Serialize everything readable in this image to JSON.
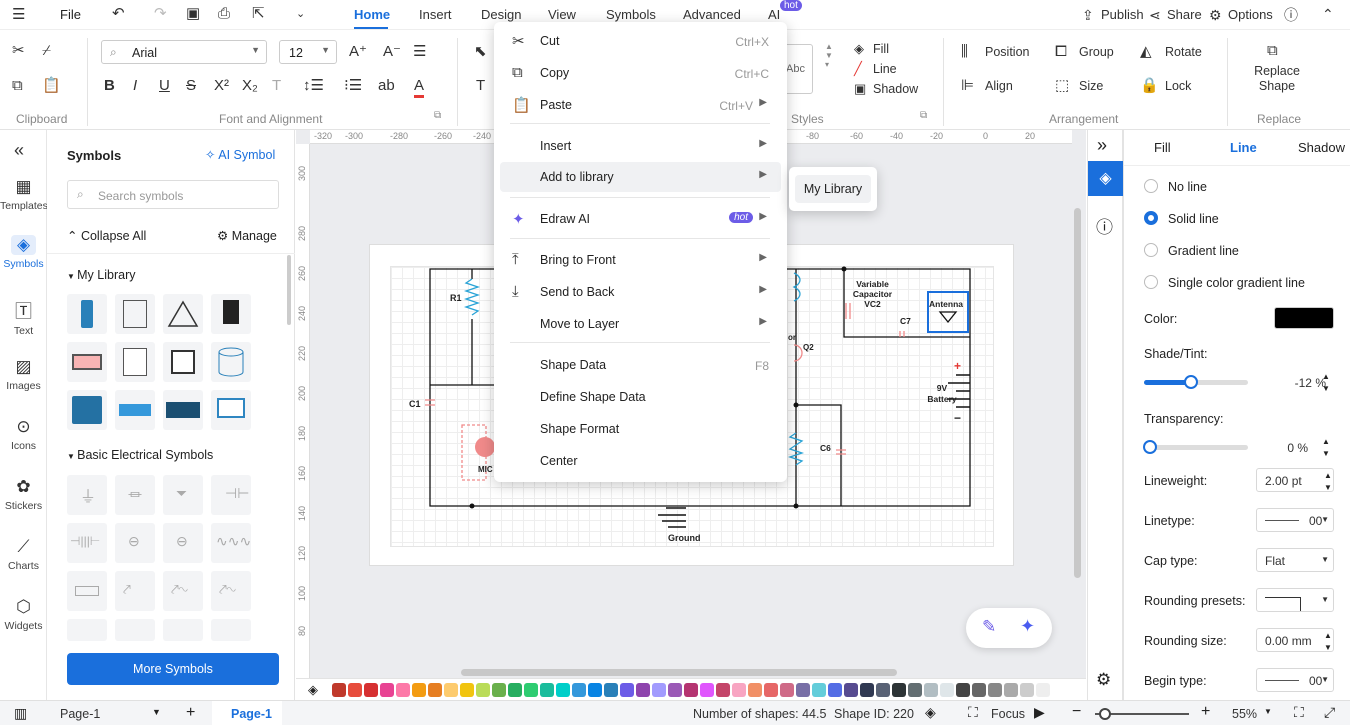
{
  "menubar": {
    "file": "File",
    "tabs": [
      "Home",
      "Insert",
      "Design",
      "View",
      "Symbols",
      "Advanced",
      "AI"
    ],
    "ai_badge": "hot",
    "publish": "Publish",
    "share": "Share",
    "options": "Options"
  },
  "ribbon": {
    "font_family": "Arial",
    "font_size": "12",
    "fill": "Fill",
    "line": "Line",
    "shadow": "Shadow",
    "position": "Position",
    "group": "Group",
    "rotate": "Rotate",
    "align": "Align",
    "size": "Size",
    "lock": "Lock",
    "replace_shape": "Replace Shape",
    "groups": {
      "clipboard": "Clipboard",
      "font": "Font and Alignment",
      "styles": "Styles",
      "arrangement": "Arrangement",
      "replace": "Replace"
    },
    "abc": "Abc"
  },
  "leftbar": [
    "Templates",
    "Symbols",
    "Text",
    "Images",
    "Icons",
    "Stickers",
    "Charts",
    "Widgets"
  ],
  "symbols": {
    "title": "Symbols",
    "ai_symbol": "AI Symbol",
    "search_placeholder": "Search symbols",
    "collapse_all": "Collapse All",
    "manage": "Manage",
    "my_library": "My Library",
    "basic_electrical": "Basic Electrical Symbols",
    "more_symbols": "More Symbols"
  },
  "canvas": {
    "ruler_top": [
      "-320",
      "-300",
      "-280",
      "-260",
      "-240",
      "-80",
      "-60",
      "-40",
      "-20",
      "0",
      "20"
    ],
    "ruler_left": [
      "300",
      "280",
      "260",
      "240",
      "220",
      "200",
      "180",
      "160",
      "140",
      "120",
      "100",
      "80"
    ],
    "labels": {
      "r1": "R1",
      "c1": "C1",
      "mic": "MIC",
      "q2": "Q2",
      "or": "or",
      "vc2": "Variable Capacitor VC2",
      "c7": "C7",
      "antenna": "Antenna",
      "battery": "9V Battery",
      "c6": "C6",
      "ground": "Ground",
      "plus": "+",
      "minus": "−"
    }
  },
  "context_menu": {
    "items": [
      {
        "label": "Cut",
        "shortcut": "Ctrl+X"
      },
      {
        "label": "Copy",
        "shortcut": "Ctrl+C"
      },
      {
        "label": "Paste",
        "shortcut": "Ctrl+V"
      },
      {
        "label": "Insert"
      },
      {
        "label": "Add to library"
      },
      {
        "label": "Edraw AI",
        "badge": "hot"
      },
      {
        "label": "Bring to Front"
      },
      {
        "label": "Send to Back"
      },
      {
        "label": "Move to Layer"
      },
      {
        "label": "Shape Data",
        "shortcut": "F8"
      },
      {
        "label": "Define Shape Data"
      },
      {
        "label": "Shape Format"
      },
      {
        "label": "Center"
      }
    ],
    "submenu": "My Library"
  },
  "right_panel": {
    "tabs": [
      "Fill",
      "Line",
      "Shadow"
    ],
    "options": [
      "No line",
      "Solid line",
      "Gradient line",
      "Single color gradient line"
    ],
    "color_label": "Color:",
    "color_value": "#000000",
    "shade_label": "Shade/Tint:",
    "shade_value": "-12 %",
    "shade_level": 0.45,
    "transparency_label": "Transparency:",
    "transparency_value": "0 %",
    "transparency_level": 0,
    "lineweight_label": "Lineweight:",
    "lineweight_value": "2.00 pt",
    "linetype_label": "Linetype:",
    "linetype_value": "00",
    "cap_label": "Cap type:",
    "cap_value": "Flat",
    "rounding_presets_label": "Rounding presets:",
    "rounding_size_label": "Rounding size:",
    "rounding_size_value": "0.00 mm",
    "begin_type_label": "Begin type:",
    "begin_type_value": "00"
  },
  "palette_colors": [
    "#c0392b",
    "#e74c3c",
    "#d63031",
    "#e84393",
    "#fd79a8",
    "#f39c12",
    "#e67e22",
    "#fdcb6e",
    "#f1c40f",
    "#badc58",
    "#6ab04c",
    "#27ae60",
    "#2ecc71",
    "#1abc9c",
    "#00cec9",
    "#3498db",
    "#0984e3",
    "#2980b9",
    "#6c5ce7",
    "#8e44ad",
    "#a29bfe",
    "#9b59b6",
    "#b53471",
    "#e056fd",
    "#c44569",
    "#f8a5c2",
    "#f19066",
    "#e66767",
    "#cf6a87",
    "#786fa6",
    "#63cdda",
    "#546de5",
    "#574b90",
    "#303952",
    "#596275",
    "#2d3436",
    "#636e72",
    "#b2bec3",
    "#dfe6e9",
    "#444444",
    "#666666",
    "#888888",
    "#aaaaaa",
    "#cccccc",
    "#eeeeee"
  ],
  "status": {
    "page_selector": "Page-1",
    "page_tab": "Page-1",
    "num_shapes": "Number of shapes: 44.5",
    "shape_id": "Shape ID: 220",
    "focus": "Focus",
    "zoom": "55%"
  }
}
